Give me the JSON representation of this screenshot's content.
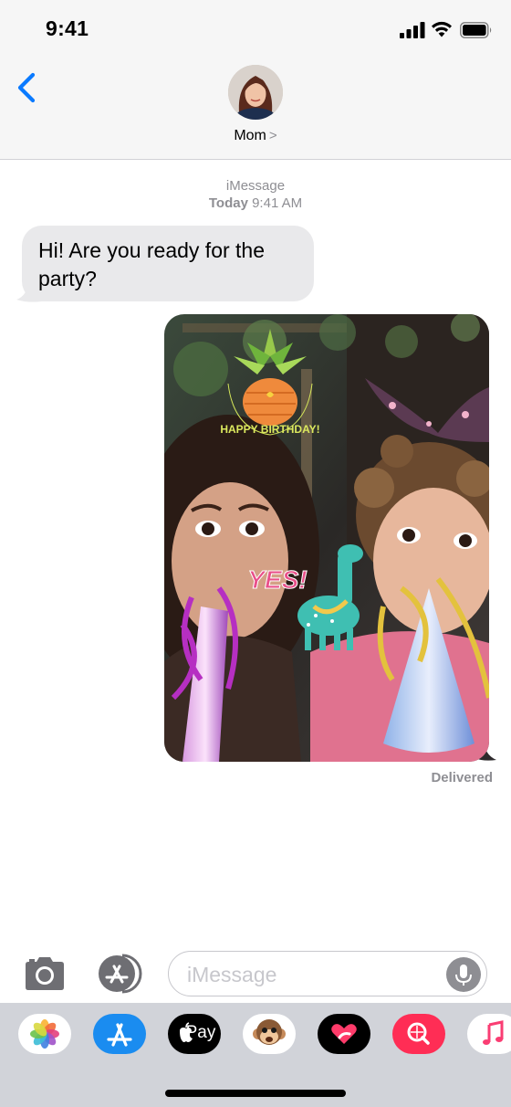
{
  "status": {
    "time": "9:41"
  },
  "header": {
    "contact_name": "Mom",
    "chevron": ">"
  },
  "meta": {
    "service": "iMessage",
    "day": "Today",
    "time": "9:41 AM"
  },
  "messages": {
    "incoming_text": "Hi! Are you ready for the party?",
    "photo_stickers": {
      "birthday": "HAPPY BIRTHDAY!",
      "yes": "YES!"
    },
    "delivered": "Delivered"
  },
  "composer": {
    "placeholder": "iMessage"
  },
  "drawer": {
    "apps": [
      "photos-icon",
      "app-store-icon",
      "apple-pay-icon",
      "animoji-icon",
      "digital-touch-icon",
      "images-search-icon",
      "music-icon"
    ],
    "apple_pay_label": " Pay"
  },
  "colors": {
    "accent": "#0a7aff",
    "bubble_in": "#e9e9eb",
    "meta_gray": "#8e8e93"
  }
}
